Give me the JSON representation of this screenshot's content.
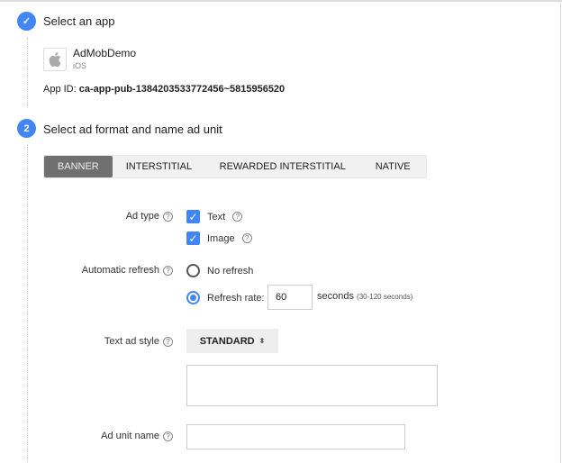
{
  "step1": {
    "number": "1",
    "title": "Select an app",
    "app_name": "AdMobDemo",
    "platform": "iOS",
    "app_id_label": "App ID:",
    "app_id": "ca-app-pub-1384203533772456~5815956520"
  },
  "step2": {
    "number": "2",
    "title": "Select ad format and name ad unit"
  },
  "tabs": [
    {
      "label": "BANNER",
      "active": true
    },
    {
      "label": "INTERSTITIAL"
    },
    {
      "label": "REWARDED INTERSTITIAL"
    },
    {
      "label": "NATIVE"
    }
  ],
  "form": {
    "ad_type_label": "Ad type",
    "ad_type_options": [
      {
        "label": "Text",
        "checked": true
      },
      {
        "label": "Image",
        "checked": true
      }
    ],
    "refresh_label": "Automatic refresh",
    "no_refresh": "No refresh",
    "refresh_rate": "Refresh rate:",
    "refresh_value": "60",
    "seconds": "seconds",
    "seconds_hint": "(30-120 seconds)",
    "text_style_label": "Text ad style",
    "text_style_value": "STANDARD",
    "ad_unit_name_label": "Ad unit name",
    "ad_unit_name_value": ""
  },
  "help_glyph": "?",
  "accent": "#4285f4"
}
